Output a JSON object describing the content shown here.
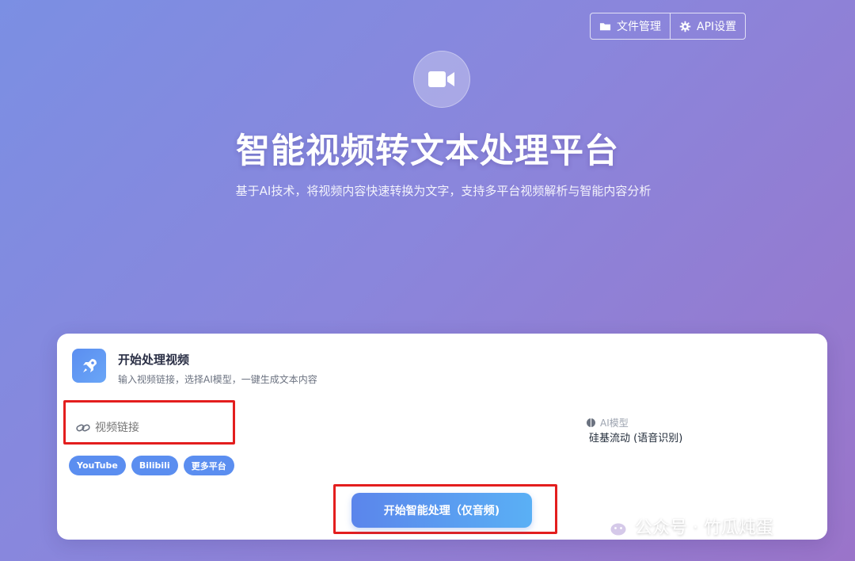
{
  "toolbar": {
    "files_label": "文件管理",
    "api_label": "API设置"
  },
  "hero": {
    "title": "智能视频转文本处理平台",
    "subtitle": "基于AI技术，将视频内容快速转换为文字，支持多平台视频解析与智能内容分析"
  },
  "card": {
    "title": "开始处理视频",
    "description": "输入视频链接，选择AI模型，一键生成文本内容",
    "url_input": {
      "placeholder": "视频链接",
      "value": ""
    },
    "platform_chips": [
      "YouTube",
      "Bilibili",
      "更多平台"
    ],
    "model": {
      "label": "AI模型",
      "value": "硅基流动 (语音识别)"
    },
    "start_button_label": "开始智能处理（仅音频)"
  },
  "watermark": {
    "text": "公众号 · 竹瓜炖蛋"
  },
  "colors": {
    "accent": "#5b8ef0",
    "highlight_box": "#e31e1e"
  },
  "icons": [
    "folder-icon",
    "gear-icon",
    "video-camera-icon",
    "rocket-icon",
    "link-icon",
    "brain-icon",
    "wechat-icon"
  ]
}
